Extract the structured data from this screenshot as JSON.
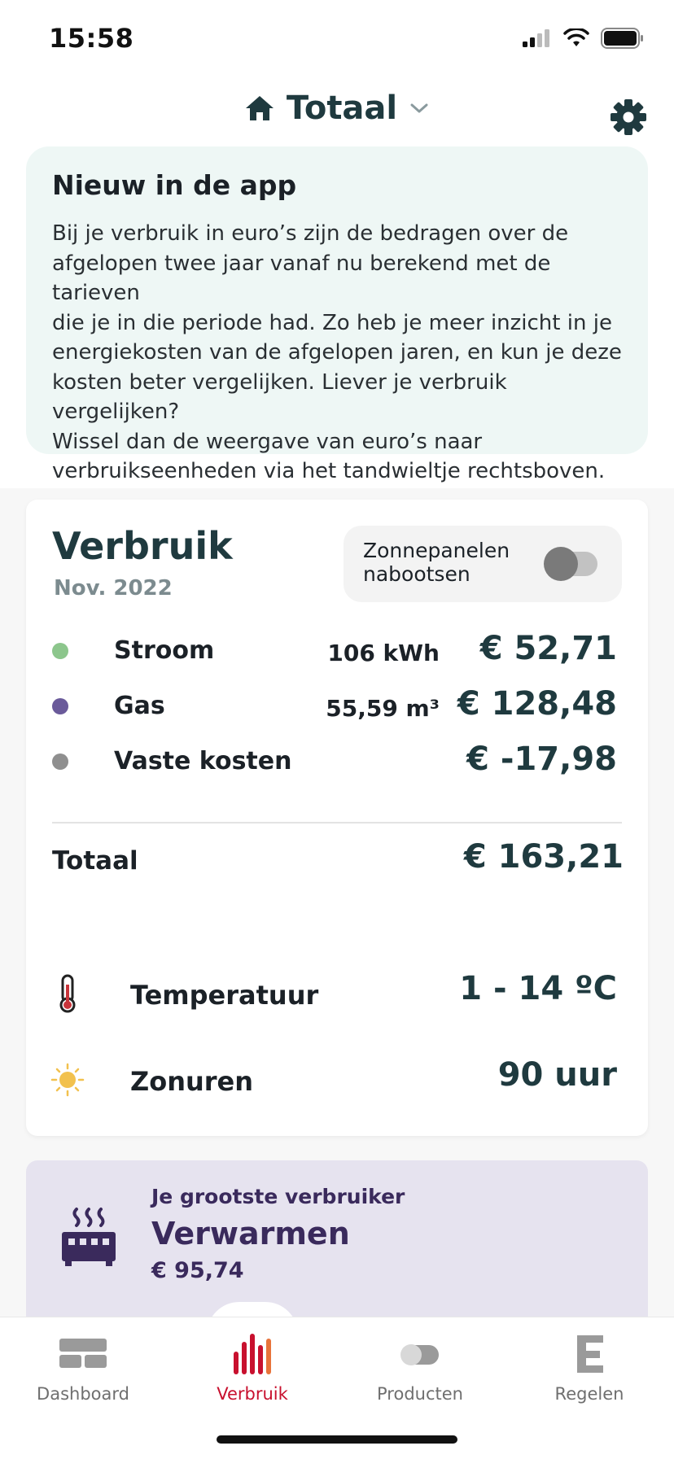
{
  "status_bar": {
    "time": "15:58"
  },
  "header": {
    "title": "Totaal"
  },
  "info_card": {
    "title": "Nieuw in de app",
    "lines": [
      "Bij je verbruik in euro’s zijn de bedragen over de",
      "afgelopen twee jaar vanaf nu berekend met de tarieven",
      "die je in die periode had. Zo heb je meer inzicht in je",
      "energiekosten van de afgelopen jaren, en kun je deze",
      "kosten beter vergelijken. Liever je verbruik vergelijken?",
      "Wissel dan de weergave van euro’s naar",
      "verbruikseenheden via het tandwieltje rechtsboven."
    ]
  },
  "usage": {
    "title": "Verbruik",
    "period": "Nov. 2022",
    "solar_toggle": {
      "label_line1": "Zonnepanelen",
      "label_line2": "nabootsen",
      "enabled": false
    },
    "rows": [
      {
        "label": "Stroom",
        "unit_value": "106 kWh",
        "amount": "€ 52,71",
        "color": "#8cc68c"
      },
      {
        "label": "Gas",
        "unit_value": "55,59 m³",
        "amount": "€ 128,48",
        "color": "#6a5a9a"
      },
      {
        "label": "Vaste kosten",
        "unit_value": "",
        "amount": "€ -17,98",
        "color": "#8f8f8f"
      }
    ],
    "total": {
      "label": "Totaal",
      "amount": "€ 163,21"
    },
    "weather": [
      {
        "label": "Temperatuur",
        "value": "1 - 14 ºC",
        "icon": "thermometer-icon"
      },
      {
        "label": "Zonuren",
        "value": "90 uur",
        "icon": "sun-icon"
      }
    ]
  },
  "biggest_consumer": {
    "kicker": "Je grootste verbruiker",
    "title": "Verwarmen",
    "amount": "€ 95,74",
    "icon": "heater-icon"
  },
  "bottom_nav": {
    "items": [
      {
        "label": "Dashboard",
        "icon": "dashboard-icon",
        "active": false
      },
      {
        "label": "Verbruik",
        "icon": "bar-chart-icon",
        "active": true
      },
      {
        "label": "Producten",
        "icon": "toggle-icon",
        "active": false
      },
      {
        "label": "Regelen",
        "icon": "eneco-e-icon",
        "active": false
      }
    ]
  },
  "colors": {
    "brand_dark": "#1f3a3f",
    "accent_red": "#c8102e",
    "purple": "#3a2a5c"
  }
}
